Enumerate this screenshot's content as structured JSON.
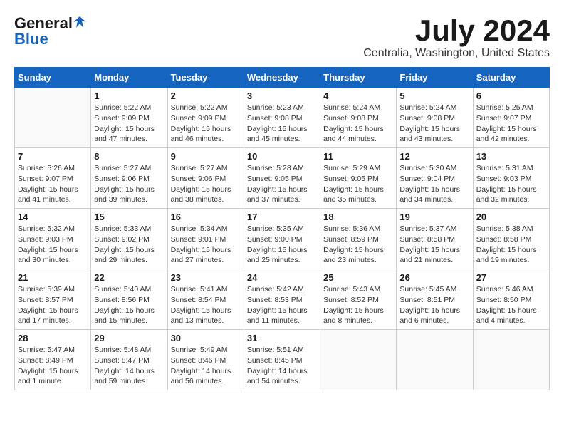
{
  "header": {
    "logo_general": "General",
    "logo_blue": "Blue",
    "main_title": "July 2024",
    "subtitle": "Centralia, Washington, United States"
  },
  "calendar": {
    "days_of_week": [
      "Sunday",
      "Monday",
      "Tuesday",
      "Wednesday",
      "Thursday",
      "Friday",
      "Saturday"
    ],
    "weeks": [
      [
        {
          "day": "",
          "detail": ""
        },
        {
          "day": "1",
          "detail": "Sunrise: 5:22 AM\nSunset: 9:09 PM\nDaylight: 15 hours\nand 47 minutes."
        },
        {
          "day": "2",
          "detail": "Sunrise: 5:22 AM\nSunset: 9:09 PM\nDaylight: 15 hours\nand 46 minutes."
        },
        {
          "day": "3",
          "detail": "Sunrise: 5:23 AM\nSunset: 9:08 PM\nDaylight: 15 hours\nand 45 minutes."
        },
        {
          "day": "4",
          "detail": "Sunrise: 5:24 AM\nSunset: 9:08 PM\nDaylight: 15 hours\nand 44 minutes."
        },
        {
          "day": "5",
          "detail": "Sunrise: 5:24 AM\nSunset: 9:08 PM\nDaylight: 15 hours\nand 43 minutes."
        },
        {
          "day": "6",
          "detail": "Sunrise: 5:25 AM\nSunset: 9:07 PM\nDaylight: 15 hours\nand 42 minutes."
        }
      ],
      [
        {
          "day": "7",
          "detail": "Sunrise: 5:26 AM\nSunset: 9:07 PM\nDaylight: 15 hours\nand 41 minutes."
        },
        {
          "day": "8",
          "detail": "Sunrise: 5:27 AM\nSunset: 9:06 PM\nDaylight: 15 hours\nand 39 minutes."
        },
        {
          "day": "9",
          "detail": "Sunrise: 5:27 AM\nSunset: 9:06 PM\nDaylight: 15 hours\nand 38 minutes."
        },
        {
          "day": "10",
          "detail": "Sunrise: 5:28 AM\nSunset: 9:05 PM\nDaylight: 15 hours\nand 37 minutes."
        },
        {
          "day": "11",
          "detail": "Sunrise: 5:29 AM\nSunset: 9:05 PM\nDaylight: 15 hours\nand 35 minutes."
        },
        {
          "day": "12",
          "detail": "Sunrise: 5:30 AM\nSunset: 9:04 PM\nDaylight: 15 hours\nand 34 minutes."
        },
        {
          "day": "13",
          "detail": "Sunrise: 5:31 AM\nSunset: 9:03 PM\nDaylight: 15 hours\nand 32 minutes."
        }
      ],
      [
        {
          "day": "14",
          "detail": "Sunrise: 5:32 AM\nSunset: 9:03 PM\nDaylight: 15 hours\nand 30 minutes."
        },
        {
          "day": "15",
          "detail": "Sunrise: 5:33 AM\nSunset: 9:02 PM\nDaylight: 15 hours\nand 29 minutes."
        },
        {
          "day": "16",
          "detail": "Sunrise: 5:34 AM\nSunset: 9:01 PM\nDaylight: 15 hours\nand 27 minutes."
        },
        {
          "day": "17",
          "detail": "Sunrise: 5:35 AM\nSunset: 9:00 PM\nDaylight: 15 hours\nand 25 minutes."
        },
        {
          "day": "18",
          "detail": "Sunrise: 5:36 AM\nSunset: 8:59 PM\nDaylight: 15 hours\nand 23 minutes."
        },
        {
          "day": "19",
          "detail": "Sunrise: 5:37 AM\nSunset: 8:58 PM\nDaylight: 15 hours\nand 21 minutes."
        },
        {
          "day": "20",
          "detail": "Sunrise: 5:38 AM\nSunset: 8:58 PM\nDaylight: 15 hours\nand 19 minutes."
        }
      ],
      [
        {
          "day": "21",
          "detail": "Sunrise: 5:39 AM\nSunset: 8:57 PM\nDaylight: 15 hours\nand 17 minutes."
        },
        {
          "day": "22",
          "detail": "Sunrise: 5:40 AM\nSunset: 8:56 PM\nDaylight: 15 hours\nand 15 minutes."
        },
        {
          "day": "23",
          "detail": "Sunrise: 5:41 AM\nSunset: 8:54 PM\nDaylight: 15 hours\nand 13 minutes."
        },
        {
          "day": "24",
          "detail": "Sunrise: 5:42 AM\nSunset: 8:53 PM\nDaylight: 15 hours\nand 11 minutes."
        },
        {
          "day": "25",
          "detail": "Sunrise: 5:43 AM\nSunset: 8:52 PM\nDaylight: 15 hours\nand 8 minutes."
        },
        {
          "day": "26",
          "detail": "Sunrise: 5:45 AM\nSunset: 8:51 PM\nDaylight: 15 hours\nand 6 minutes."
        },
        {
          "day": "27",
          "detail": "Sunrise: 5:46 AM\nSunset: 8:50 PM\nDaylight: 15 hours\nand 4 minutes."
        }
      ],
      [
        {
          "day": "28",
          "detail": "Sunrise: 5:47 AM\nSunset: 8:49 PM\nDaylight: 15 hours\nand 1 minute."
        },
        {
          "day": "29",
          "detail": "Sunrise: 5:48 AM\nSunset: 8:47 PM\nDaylight: 14 hours\nand 59 minutes."
        },
        {
          "day": "30",
          "detail": "Sunrise: 5:49 AM\nSunset: 8:46 PM\nDaylight: 14 hours\nand 56 minutes."
        },
        {
          "day": "31",
          "detail": "Sunrise: 5:51 AM\nSunset: 8:45 PM\nDaylight: 14 hours\nand 54 minutes."
        },
        {
          "day": "",
          "detail": ""
        },
        {
          "day": "",
          "detail": ""
        },
        {
          "day": "",
          "detail": ""
        }
      ]
    ]
  }
}
